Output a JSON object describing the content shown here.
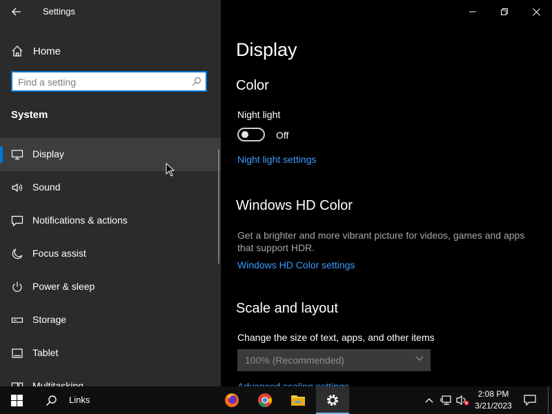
{
  "window": {
    "title": "Settings"
  },
  "sidebar": {
    "home_label": "Home",
    "search_placeholder": "Find a setting",
    "section_title": "System",
    "items": [
      {
        "label": "Display",
        "icon": "monitor-icon",
        "active": true
      },
      {
        "label": "Sound",
        "icon": "speaker-icon"
      },
      {
        "label": "Notifications & actions",
        "icon": "notification-icon"
      },
      {
        "label": "Focus assist",
        "icon": "moon-icon"
      },
      {
        "label": "Power & sleep",
        "icon": "power-icon"
      },
      {
        "label": "Storage",
        "icon": "storage-icon"
      },
      {
        "label": "Tablet",
        "icon": "tablet-icon"
      },
      {
        "label": "Multitasking",
        "icon": "multitasking-icon"
      }
    ]
  },
  "main": {
    "page_title": "Display",
    "color": {
      "heading": "Color",
      "night_light_label": "Night light",
      "night_light_state": "Off",
      "night_light_link": "Night light settings"
    },
    "hdr": {
      "heading": "Windows HD Color",
      "description": "Get a brighter and more vibrant picture for videos, games and apps that support HDR.",
      "link": "Windows HD Color settings"
    },
    "scale": {
      "heading": "Scale and layout",
      "label": "Change the size of text, apps, and other items",
      "value": "100% (Recommended)",
      "link": "Advanced scaling settings"
    }
  },
  "taskbar": {
    "links_label": "Links",
    "apps": [
      "firefox-icon",
      "chrome-icon",
      "file-explorer-icon",
      "settings-icon"
    ],
    "time": "2:08 PM",
    "date": "3/21/2023"
  },
  "colors": {
    "accent": "#0078d7",
    "link": "#3b9cff",
    "sidebar_bg": "#2b2b2b",
    "main_bg": "#000000"
  }
}
